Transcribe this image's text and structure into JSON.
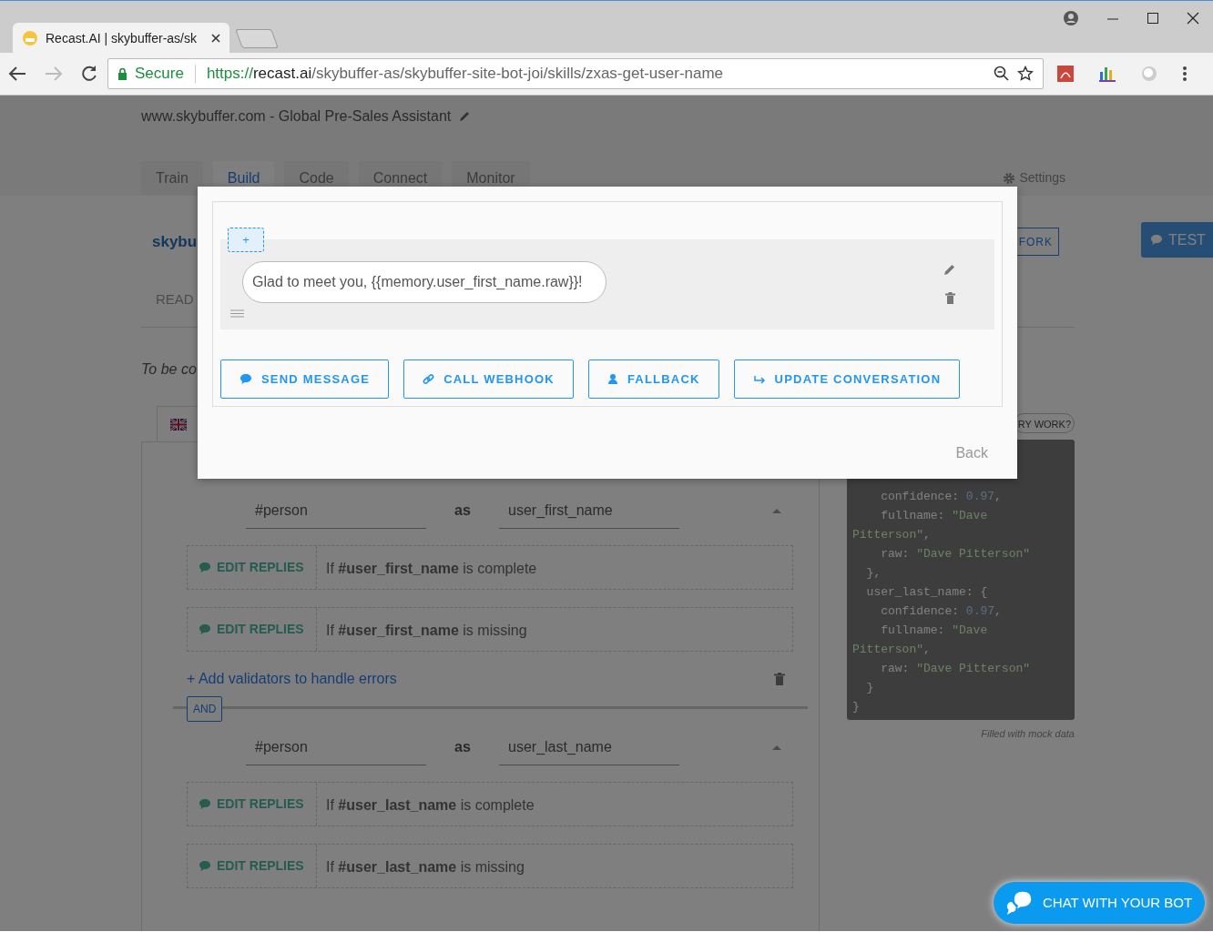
{
  "browser": {
    "tab": {
      "title": "Recast.AI | skybuffer-as/sk"
    },
    "address": {
      "secure_label": "Secure",
      "scheme": "https://",
      "host": "recast.ai",
      "path": "/skybuffer-as/skybuffer-site-bot-joi/skills/zxas-get-user-name"
    }
  },
  "header": {
    "subtitle": "www.skybuffer.com - Global Pre-Sales Assistant",
    "tabs": [
      {
        "label": "Train",
        "selected": false
      },
      {
        "label": "Build",
        "selected": true
      },
      {
        "label": "Code",
        "selected": false
      },
      {
        "label": "Connect",
        "selected": false
      },
      {
        "label": "Monitor",
        "selected": false
      }
    ],
    "settings": "Settings"
  },
  "skill": {
    "title": "skybu",
    "fork": "FORK",
    "test": "TEST",
    "readme_tab": "READ",
    "description": "To be co"
  },
  "requirements": [
    {
      "entity": "#person",
      "as": "as",
      "name": "user_first_name",
      "replies": [
        {
          "label": "EDIT REPLIES",
          "condition": "If **#user_first_name** is complete"
        },
        {
          "label": "EDIT REPLIES",
          "condition": "If **#user_first_name** is missing"
        }
      ],
      "add_validators": "+ Add validators to handle errors"
    },
    {
      "connector": "AND",
      "entity": "#person",
      "as": "as",
      "name": "user_last_name",
      "replies": [
        {
          "label": "EDIT REPLIES",
          "condition": "If **#user_last_name** is complete"
        },
        {
          "label": "EDIT REPLIES",
          "condition": "If **#user_last_name** is missing"
        }
      ]
    }
  ],
  "memory_panel": {
    "query_button": "RY WORK?",
    "lines": [
      [
        {
          "t": "    confidence: ",
          "kind": "key"
        },
        {
          "t": "0.97",
          "kind": "number"
        },
        {
          "t": ",",
          "kind": "punct"
        }
      ],
      [
        {
          "t": "    fullname: ",
          "kind": "key"
        },
        {
          "t": "\"Dave",
          "kind": "string"
        }
      ],
      [
        {
          "t": "Pitterson\"",
          "kind": "string"
        },
        {
          "t": ",",
          "kind": "punct"
        }
      ],
      [
        {
          "t": "    raw: ",
          "kind": "key"
        },
        {
          "t": "\"Dave Pitterson\"",
          "kind": "string"
        }
      ],
      [
        {
          "t": "  },",
          "kind": "punct"
        }
      ],
      [
        {
          "t": "  user_last_name: ",
          "kind": "key"
        },
        {
          "t": "{",
          "kind": "punct"
        }
      ],
      [
        {
          "t": "    confidence: ",
          "kind": "key"
        },
        {
          "t": "0.97",
          "kind": "number"
        },
        {
          "t": ",",
          "kind": "punct"
        }
      ],
      [
        {
          "t": "    fullname: ",
          "kind": "key"
        },
        {
          "t": "\"Dave",
          "kind": "string"
        }
      ],
      [
        {
          "t": "Pitterson\"",
          "kind": "string"
        },
        {
          "t": ",",
          "kind": "punct"
        }
      ],
      [
        {
          "t": "    raw: ",
          "kind": "key"
        },
        {
          "t": "\"Dave Pitterson\"",
          "kind": "string"
        }
      ],
      [
        {
          "t": "  }",
          "kind": "punct"
        }
      ],
      [
        {
          "t": "}",
          "kind": "punct"
        }
      ]
    ],
    "note": "Filled with mock data"
  },
  "modal": {
    "add_label": "+",
    "messages": [
      {
        "text": "Glad to meet you, {{memory.user_first_name.raw}}!"
      }
    ],
    "actions": [
      {
        "label": "SEND MESSAGE",
        "kind": "message"
      },
      {
        "label": "CALL WEBHOOK",
        "kind": "webhook"
      },
      {
        "label": "FALLBACK",
        "kind": "fallback"
      },
      {
        "label": "UPDATE CONVERSATION",
        "kind": "update"
      }
    ],
    "back": "Back"
  },
  "chat_button": "CHAT WITH YOUR BOT"
}
